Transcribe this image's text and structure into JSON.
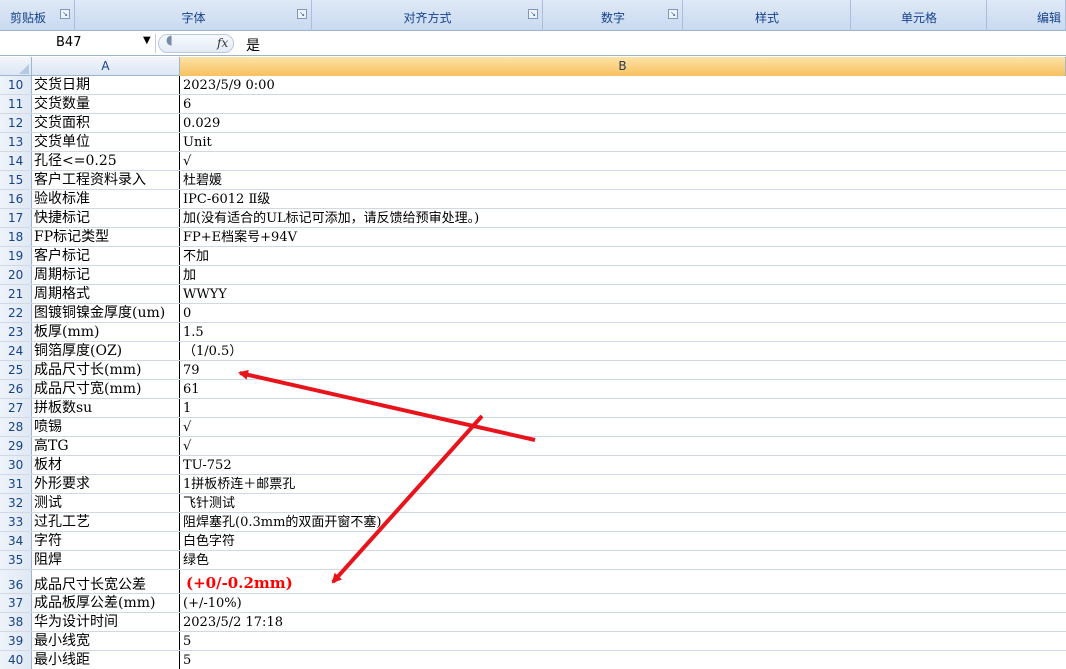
{
  "ribbon": {
    "groups": [
      {
        "label": "剪贴板",
        "launcher": true
      },
      {
        "label": "字体",
        "launcher": true
      },
      {
        "label": "对齐方式",
        "launcher": true
      },
      {
        "label": "数字",
        "launcher": true
      },
      {
        "label": "样式",
        "launcher": false
      },
      {
        "label": "单元格",
        "launcher": false
      },
      {
        "label": "编辑",
        "launcher": false
      }
    ]
  },
  "formula_bar": {
    "name_box": "B47",
    "fx_label": "fx",
    "value": "是"
  },
  "columns": [
    "A",
    "B"
  ],
  "rows": [
    {
      "num": "10",
      "a": "交货日期",
      "b": "2023/5/9 0:00"
    },
    {
      "num": "11",
      "a": "交货数量",
      "b": "6"
    },
    {
      "num": "12",
      "a": "交货面积",
      "b": "0.029"
    },
    {
      "num": "13",
      "a": "交货单位",
      "b": "Unit"
    },
    {
      "num": "14",
      "a": "孔径<=0.25",
      "b": "√"
    },
    {
      "num": "15",
      "a": "客户工程资料录入",
      "b": "杜碧媛"
    },
    {
      "num": "16",
      "a": "验收标准",
      "b": "IPC-6012 Ⅱ级"
    },
    {
      "num": "17",
      "a": "快捷标记",
      "b": "加(没有适合的UL标记可添加，请反馈给预审处理。)"
    },
    {
      "num": "18",
      "a": "FP标记类型",
      "b": "FP+E档案号+94V"
    },
    {
      "num": "19",
      "a": "客户标记",
      "b": "不加"
    },
    {
      "num": "20",
      "a": "周期标记",
      "b": "加"
    },
    {
      "num": "21",
      "a": "周期格式",
      "b": "WWYY"
    },
    {
      "num": "22",
      "a": "图镀铜镍金厚度(um)",
      "b": "0"
    },
    {
      "num": "23",
      "a": "板厚(mm)",
      "b": "1.5"
    },
    {
      "num": "24",
      "a": "铜箔厚度(OZ)",
      "b": "（1/0.5）"
    },
    {
      "num": "25",
      "a": "成品尺寸长(mm)",
      "b": "79"
    },
    {
      "num": "26",
      "a": "成品尺寸宽(mm)",
      "b": "61"
    },
    {
      "num": "27",
      "a": "拼板数su",
      "b": "1"
    },
    {
      "num": "28",
      "a": "喷锡",
      "b": "√"
    },
    {
      "num": "29",
      "a": "高TG",
      "b": "√"
    },
    {
      "num": "30",
      "a": "板材",
      "b": "TU-752"
    },
    {
      "num": "31",
      "a": "外形要求",
      "b": "1拼板桥连＋邮票孔"
    },
    {
      "num": "32",
      "a": "测试",
      "b": "飞针测试"
    },
    {
      "num": "33",
      "a": "过孔工艺",
      "b": "阻焊塞孔(0.3mm的双面开窗不塞)"
    },
    {
      "num": "34",
      "a": "字符",
      "b": "白色字符"
    },
    {
      "num": "35",
      "a": "阻焊",
      "b": "绿色"
    },
    {
      "num": "36",
      "a": "成品尺寸长宽公差",
      "b": "(+0/-0.2mm)",
      "highlight": true
    },
    {
      "num": "37",
      "a": "成品板厚公差(mm)",
      "b": "(+/-10%)"
    },
    {
      "num": "38",
      "a": "华为设计时间",
      "b": "2023/5/2 17:18"
    },
    {
      "num": "39",
      "a": "最小线宽",
      "b": "5"
    },
    {
      "num": "40",
      "a": "最小线距",
      "b": "5"
    }
  ],
  "colors": {
    "annotation_arrow": "#e8141b",
    "highlight_text": "#ff0000",
    "selected_column_header": "#f7c15f"
  }
}
